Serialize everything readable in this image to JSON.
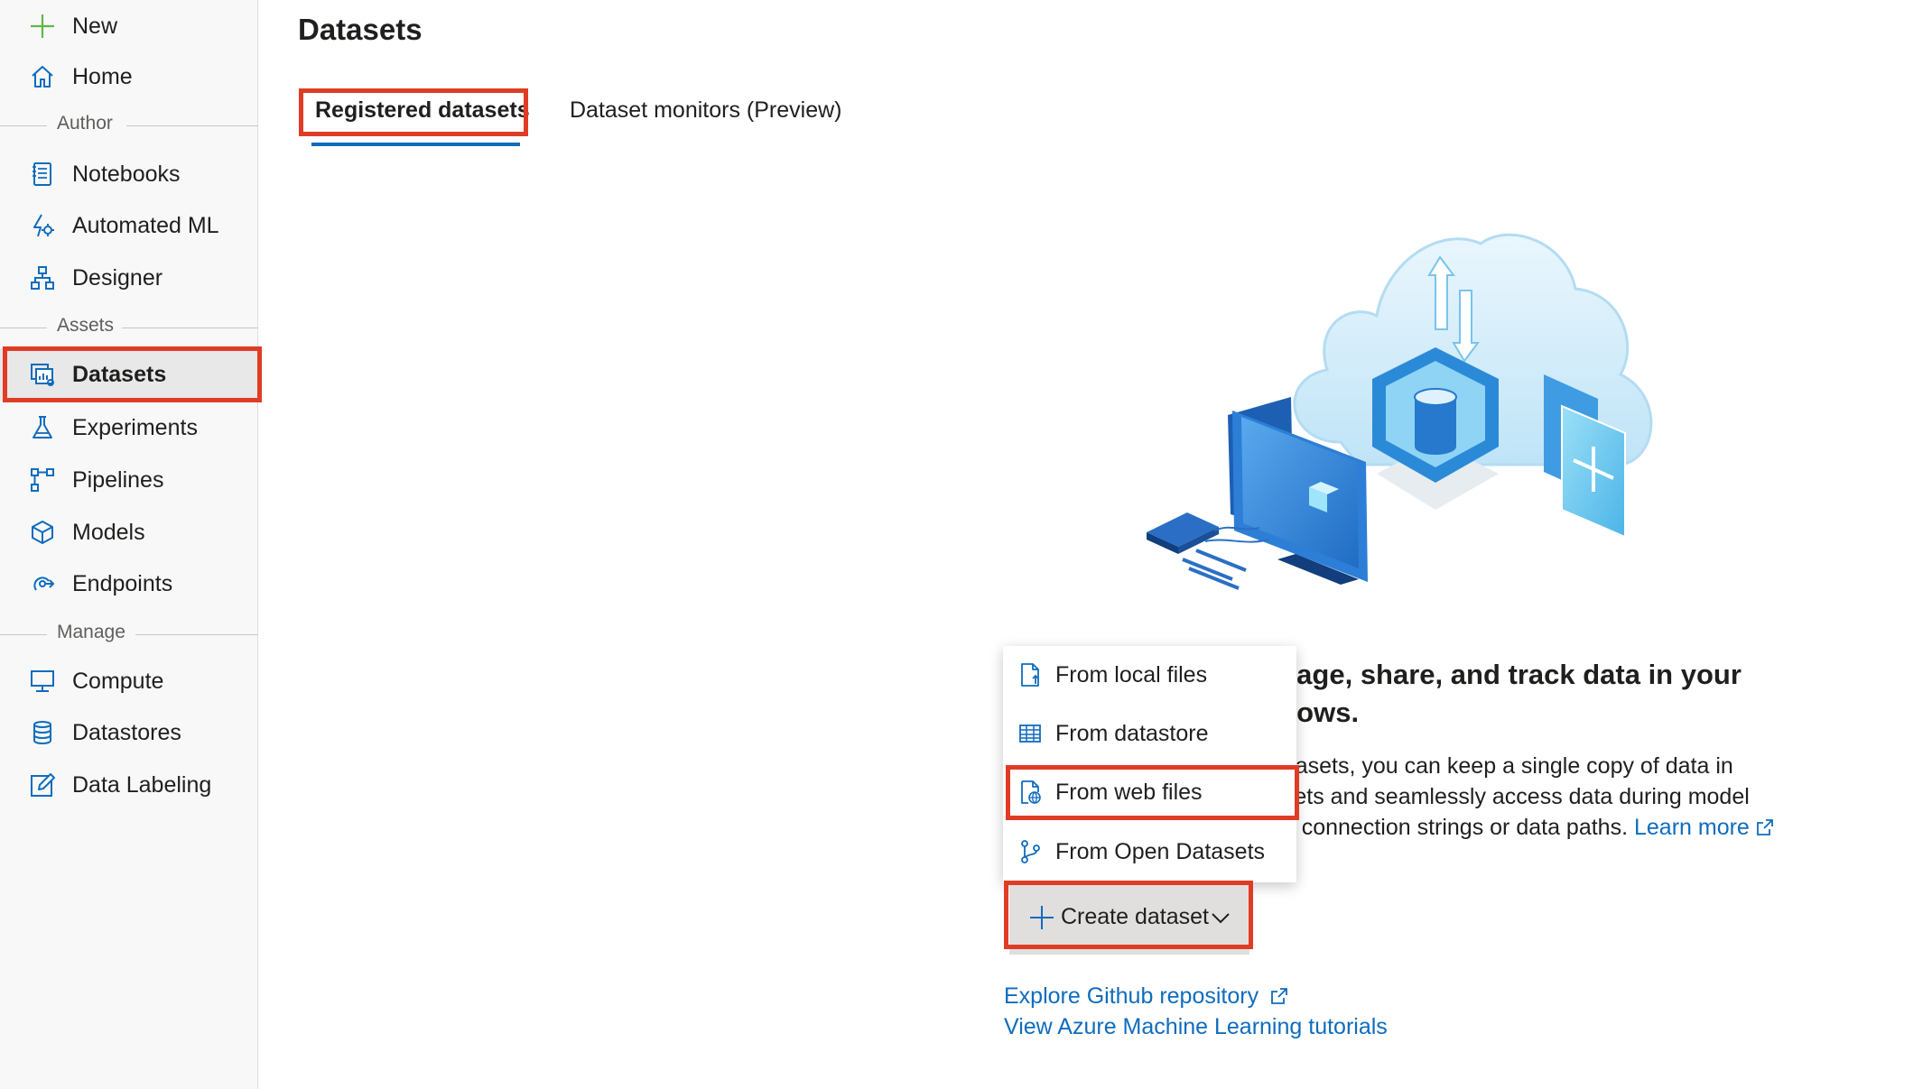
{
  "sidebar": {
    "top_items": [
      {
        "label": "New",
        "icon": "plus-icon"
      },
      {
        "label": "Home",
        "icon": "home-icon"
      }
    ],
    "sections": {
      "author": "Author",
      "assets": "Assets",
      "manage": "Manage"
    },
    "author_items": [
      {
        "label": "Notebooks",
        "icon": "notebook-icon"
      },
      {
        "label": "Automated ML",
        "icon": "automated-ml-icon"
      },
      {
        "label": "Designer",
        "icon": "designer-icon"
      }
    ],
    "assets_items": [
      {
        "label": "Datasets",
        "icon": "datasets-icon",
        "selected": true
      },
      {
        "label": "Experiments",
        "icon": "flask-icon"
      },
      {
        "label": "Pipelines",
        "icon": "pipelines-icon"
      },
      {
        "label": "Models",
        "icon": "cube-icon"
      },
      {
        "label": "Endpoints",
        "icon": "endpoints-icon"
      }
    ],
    "manage_items": [
      {
        "label": "Compute",
        "icon": "monitor-icon"
      },
      {
        "label": "Datastores",
        "icon": "database-icon"
      },
      {
        "label": "Data Labeling",
        "icon": "edit-icon"
      }
    ]
  },
  "main": {
    "title": "Datasets",
    "tabs": [
      {
        "label": "Registered datasets",
        "active": true
      },
      {
        "label": "Dataset monitors (Preview)",
        "active": false
      }
    ],
    "heading": "anage, share, and track data in your kflows.",
    "heading_line1": "anage, share, and track data in your",
    "heading_line2": "kflows.",
    "desc_line1": "datasets, you can keep a single copy of data in",
    "desc_line2": "tasets and seamlessly access data during model",
    "desc_line3": "out connection strings or data paths.",
    "learn_more": "Learn more",
    "create_button": "Create dataset",
    "dropdown": [
      {
        "label": "From local files",
        "icon": "file-upload-icon"
      },
      {
        "label": "From datastore",
        "icon": "table-icon"
      },
      {
        "label": "From web files",
        "icon": "web-file-icon"
      },
      {
        "label": "From Open Datasets",
        "icon": "open-datasets-icon"
      }
    ],
    "links": {
      "github": "Explore Github repository",
      "tutorials": "View Azure Machine Learning tutorials"
    }
  },
  "colors": {
    "accent": "#0f6cbd",
    "highlight": "#e03c25",
    "new_plus": "#4caf50"
  }
}
